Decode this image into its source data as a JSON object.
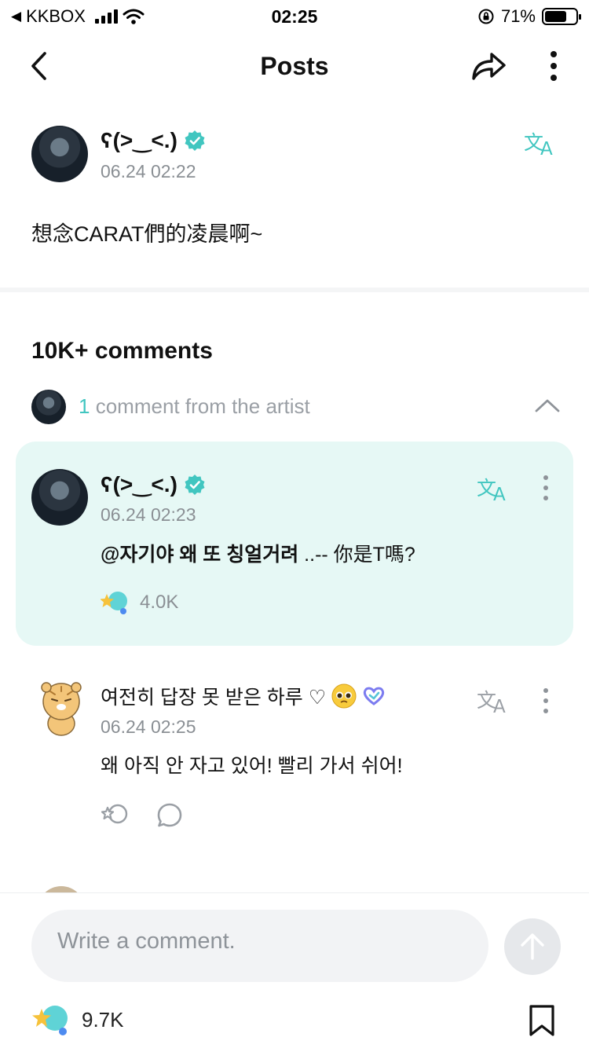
{
  "status_bar": {
    "carrier": "KKBOX",
    "time": "02:25",
    "battery": "71%",
    "battery_level": 0.71
  },
  "header": {
    "title": "Posts",
    "icons": [
      "back-icon",
      "share-icon",
      "more-icon"
    ]
  },
  "post": {
    "author": "ʕ(>‿<.)",
    "date": "06.24 02:22",
    "text": "想念CARAT們的凌晨啊~"
  },
  "comments": {
    "title": "10K+ comments",
    "artist_count": "1",
    "artist_label": "comment from the artist"
  },
  "artist_comment": {
    "author": "ʕ(>‿<.)",
    "date": "06.24 02:23",
    "mention": "@자기야 왜 또 칭얼거려",
    "text": "..-- 你是T嗎?",
    "likes": "4.0K"
  },
  "fan_comment": {
    "author": "여전히 답장 못 받은 하루 ♡",
    "date": "06.24 02:25",
    "text": "왜 아직 안 자고 있어! 빨리 가서 쉬어!"
  },
  "composer": {
    "placeholder": "Write a comment.",
    "likes": "9.7K"
  },
  "colors": {
    "accent": "#41c6c0",
    "card_bg": "#e6f8f5"
  }
}
